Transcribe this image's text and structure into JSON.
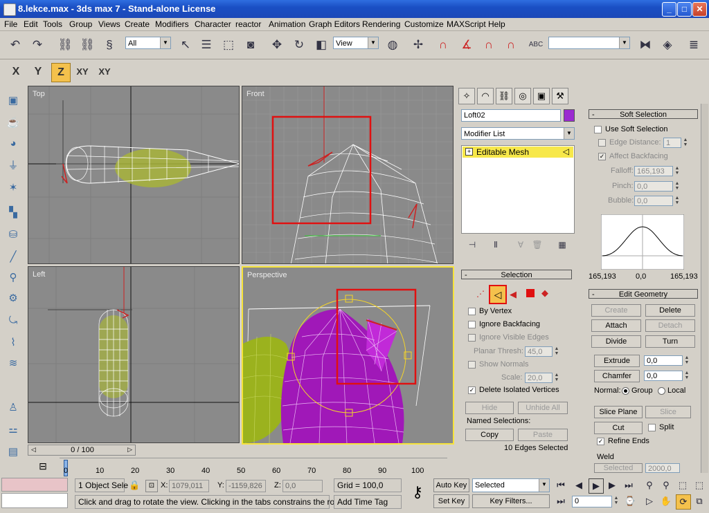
{
  "window": {
    "title": "8.lekce.max - 3ds max 7 - Stand-alone License",
    "min": "_",
    "max": "□",
    "close": "✕"
  },
  "menu": [
    "File",
    "Edit",
    "Tools",
    "Group",
    "Views",
    "Create",
    "Modifiers",
    "Character",
    "reactor",
    "Animation",
    "Graph Editors",
    "Rendering",
    "Customize",
    "MAXScript",
    "Help"
  ],
  "toolbar": {
    "selection_filter": "All",
    "ref_coord": "View",
    "named_sel": "",
    "snap_angle": "3",
    "snap_percent": "%"
  },
  "axis": {
    "x": "X",
    "y": "Y",
    "z": "Z",
    "xy": "XY",
    "xy2": "XY",
    "active": "Z"
  },
  "viewports": {
    "top": "Top",
    "front": "Front",
    "left": "Left",
    "perspective": "Perspective"
  },
  "command_panel": {
    "object_name": "Loft02",
    "object_color": "#9a2ad0",
    "modifier_list": "Modifier List",
    "stack_item": "Editable Mesh",
    "selection": {
      "title": "Selection",
      "by_vertex": "By Vertex",
      "ignore_backfacing": "Ignore Backfacing",
      "ignore_visible_edges": "Ignore Visible Edges",
      "planar_thresh_label": "Planar Thresh:",
      "planar_thresh": "45,0",
      "show_normals": "Show Normals",
      "scale_label": "Scale:",
      "scale": "20,0",
      "delete_isolated": "Delete Isolated Vertices",
      "hide": "Hide",
      "unhide_all": "Unhide All",
      "named_selections": "Named Selections:",
      "copy": "Copy",
      "paste": "Paste",
      "status": "10 Edges Selected"
    }
  },
  "soft_selection": {
    "title": "Soft Selection",
    "use_soft": "Use Soft Selection",
    "edge_distance": "Edge Distance:",
    "edge_distance_val": "1",
    "affect_backfacing": "Affect Backfacing",
    "falloff_label": "Falloff:",
    "falloff": "165,193",
    "pinch_label": "Pinch:",
    "pinch": "0,0",
    "bubble_label": "Bubble:",
    "bubble": "0,0",
    "curve_left": "165,193",
    "curve_mid": "0,0",
    "curve_right": "165,193"
  },
  "edit_geometry": {
    "title": "Edit Geometry",
    "create": "Create",
    "delete": "Delete",
    "attach": "Attach",
    "detach": "Detach",
    "divide": "Divide",
    "turn": "Turn",
    "extrude": "Extrude",
    "extrude_val": "0,0",
    "chamfer": "Chamfer",
    "chamfer_val": "0,0",
    "normal_label": "Normal:",
    "group": "Group",
    "local": "Local",
    "slice_plane": "Slice Plane",
    "slice": "Slice",
    "cut": "Cut",
    "split": "Split",
    "refine_ends": "Refine Ends",
    "weld": "Weld",
    "selected": "Selected",
    "selected_val": "2000,0"
  },
  "timeline": {
    "slider": "0 / 100",
    "ticks": [
      "0",
      "10",
      "20",
      "30",
      "40",
      "50",
      "60",
      "70",
      "80",
      "90",
      "100"
    ]
  },
  "status": {
    "selected_objects": "1 Object Sele",
    "x_label": "X:",
    "x": "1079,011",
    "y_label": "Y:",
    "y": "-1159,826",
    "z_label": "Z:",
    "z": "0,0",
    "grid": "Grid = 100,0",
    "prompt": "Click and drag to rotate the view.  Clicking in the tabs constrains the rotation",
    "add_time_tag": "Add Time Tag",
    "auto_key": "Auto Key",
    "set_key": "Set Key",
    "key_mode": "Selected",
    "key_filters": "Key Filters...",
    "frame": "0"
  }
}
